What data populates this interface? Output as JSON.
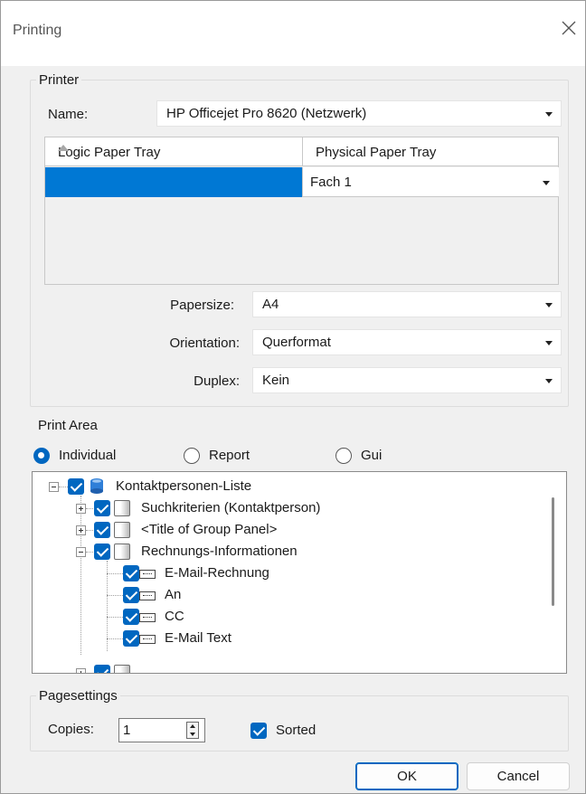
{
  "window": {
    "title": "Printing"
  },
  "printer": {
    "legend": "Printer",
    "name_label": "Name:",
    "name_value": "HP Officejet Pro 8620 (Netzwerk)",
    "tray_grid": {
      "col_logic": "Logic Paper Tray",
      "col_physical": "Physical Paper Tray",
      "rows": [
        {
          "logic": "",
          "physical": "Fach 1"
        }
      ]
    },
    "papersize_label": "Papersize:",
    "papersize_value": "A4",
    "orientation_label": "Orientation:",
    "orientation_value": "Querformat",
    "duplex_label": "Duplex:",
    "duplex_value": "Kein"
  },
  "print_area": {
    "legend": "Print Area",
    "options": [
      {
        "label": "Individual",
        "selected": true
      },
      {
        "label": "Report",
        "selected": false
      },
      {
        "label": "Gui",
        "selected": false
      }
    ],
    "tree": {
      "root": "Kontaktpersonen-Liste",
      "item_suchkriterien": "Suchkriterien (Kontaktperson)",
      "item_group_panel": "<Title of Group Panel>",
      "item_rechnung": "Rechnungs-Informationen",
      "leaf_email_rechnung": "E-Mail-Rechnung",
      "leaf_an": "An",
      "leaf_cc": "CC",
      "leaf_email_text": "E-Mail Text"
    }
  },
  "pagesettings": {
    "legend": "Pagesettings",
    "copies_label": "Copies:",
    "copies_value": "1",
    "sorted_label": "Sorted",
    "sorted_checked": true
  },
  "buttons": {
    "ok": "OK",
    "cancel": "Cancel"
  },
  "colors": {
    "accent": "#0067c0",
    "selection": "#0078d4"
  }
}
